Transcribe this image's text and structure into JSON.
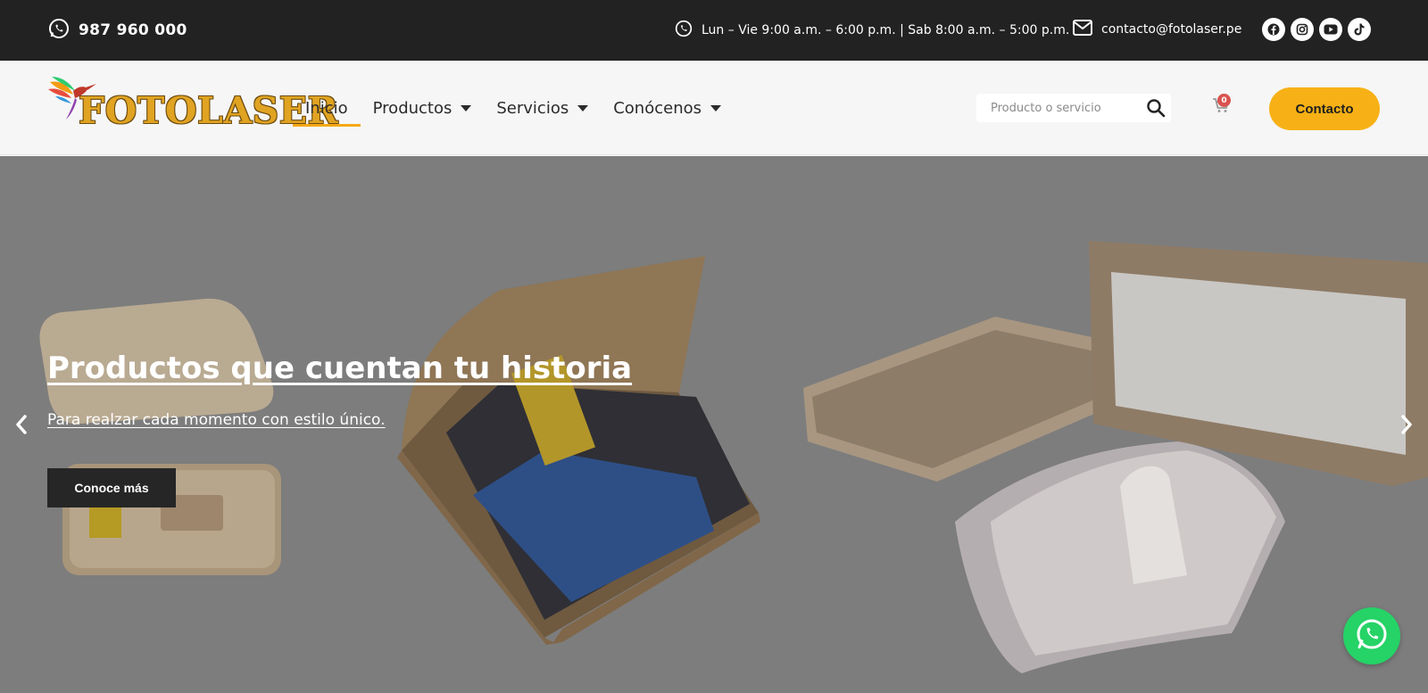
{
  "topbar": {
    "phone": "987 960 000",
    "hours": "Lun – Vie 9:00 a.m. – 6:00 p.m. | Sab 8:00 a.m. – 5:00 p.m.",
    "email": "contacto@fotolaser.pe",
    "socials": [
      "facebook-icon",
      "instagram-icon",
      "youtube-icon",
      "tiktok-icon"
    ]
  },
  "header": {
    "logo_text": "FOTOLASER",
    "nav": [
      {
        "label": "Inicio",
        "active": true
      },
      {
        "label": "Productos",
        "dropdown": true
      },
      {
        "label": "Servicios",
        "dropdown": true
      },
      {
        "label": "Conócenos",
        "dropdown": true
      }
    ],
    "search_placeholder": "Producto o servicio",
    "cart_count": "0",
    "contact_label": "Contacto"
  },
  "hero": {
    "title": "Productos que cuentan tu historia",
    "subtitle": "Para realzar cada momento con estilo único.",
    "cta_label": "Conoce más"
  },
  "colors": {
    "topbar_bg": "#222222",
    "accent": "#f7b116",
    "whatsapp": "#25d366",
    "hero_overlay": "#7d7d7d"
  }
}
